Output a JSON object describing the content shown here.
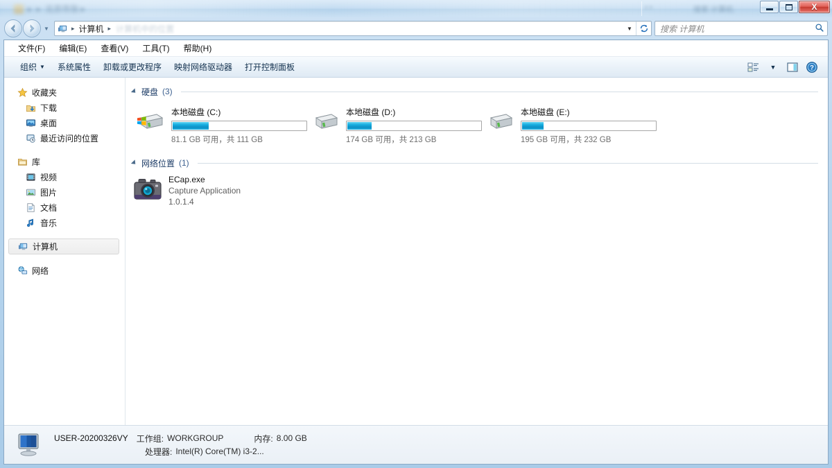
{
  "window": {
    "controls": {
      "minimize": "–",
      "maximize": "❐",
      "close": "X"
    }
  },
  "nav": {
    "back_title": "后退",
    "forward_title": "前进",
    "breadcrumb": {
      "root_icon": "computer-icon",
      "items": [
        "计算机"
      ],
      "separator": "▸"
    },
    "address_caret": "▼",
    "refresh": "↻"
  },
  "search": {
    "placeholder": "搜索 计算机",
    "value": "",
    "icon": "search-icon"
  },
  "menubar": {
    "items": [
      "文件(F)",
      "编辑(E)",
      "查看(V)",
      "工具(T)",
      "帮助(H)"
    ]
  },
  "commandbar": {
    "organize": "组织",
    "organize_caret": "▼",
    "items": [
      "系统属性",
      "卸载或更改程序",
      "映射网络驱动器",
      "打开控制面板"
    ],
    "view_caret": "▼"
  },
  "sidebar": {
    "groups": [
      {
        "header": {
          "label": "收藏夹",
          "icon": "star-icon"
        },
        "items": [
          {
            "label": "下载",
            "icon": "downloads-icon"
          },
          {
            "label": "桌面",
            "icon": "desktop-icon"
          },
          {
            "label": "最近访问的位置",
            "icon": "recent-places-icon"
          }
        ]
      },
      {
        "header": {
          "label": "库",
          "icon": "library-icon"
        },
        "items": [
          {
            "label": "视频",
            "icon": "video-icon"
          },
          {
            "label": "图片",
            "icon": "pictures-icon"
          },
          {
            "label": "文档",
            "icon": "documents-icon"
          },
          {
            "label": "音乐",
            "icon": "music-icon"
          }
        ]
      },
      {
        "header": {
          "label": "计算机",
          "icon": "computer-icon",
          "selected": true
        },
        "items": []
      },
      {
        "header": {
          "label": "网络",
          "icon": "network-icon"
        },
        "items": []
      }
    ]
  },
  "content": {
    "groups": [
      {
        "name": "hard-disks",
        "title": "硬盘",
        "count": "(3)",
        "drives": [
          {
            "name": "本地磁盘 (C:)",
            "free": "81.1 GB",
            "total": "111 GB",
            "detail": "81.1 GB 可用，共 111 GB",
            "used_percent": 27,
            "icon": "system-drive-icon"
          },
          {
            "name": "本地磁盘 (D:)",
            "free": "174 GB",
            "total": "213 GB",
            "detail": "174 GB 可用，共 213 GB",
            "used_percent": 18,
            "icon": "drive-icon"
          },
          {
            "name": "本地磁盘 (E:)",
            "free": "195 GB",
            "total": "232 GB",
            "detail": "195 GB 可用，共 232 GB",
            "used_percent": 16,
            "icon": "drive-icon"
          }
        ]
      },
      {
        "name": "network-locations",
        "title": "网络位置",
        "count": "(1)",
        "apps": [
          {
            "name": "ECap.exe",
            "description": "Capture Application",
            "version": "1.0.1.4",
            "icon": "camera-icon"
          }
        ]
      }
    ]
  },
  "status": {
    "computer_name": "USER-20200326VY",
    "workgroup_label": "工作组:",
    "workgroup_value": "WORKGROUP",
    "memory_label": "内存:",
    "memory_value": "8.00 GB",
    "processor_label": "处理器:",
    "processor_value": "Intel(R) Core(TM) i3-2...",
    "icon": "computer-icon"
  },
  "colors": {
    "accent": "#15aee0",
    "frame": "#a9cbe8",
    "group_title": "#1f3e68",
    "close_button": "#c53b31"
  }
}
